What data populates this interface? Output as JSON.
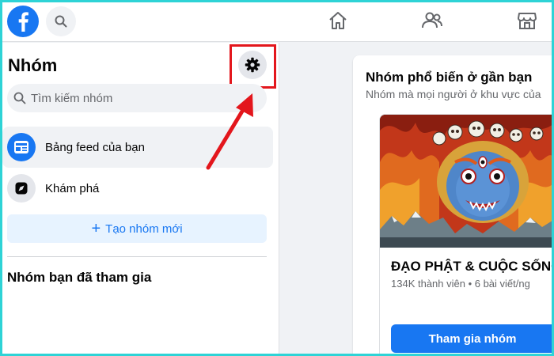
{
  "topbar": {
    "logo_icon": "facebook-logo-icon",
    "search_icon": "search-icon",
    "nav_icons": [
      "home-icon",
      "friends-icon",
      "marketplace-icon"
    ]
  },
  "sidebar": {
    "title": "Nhóm",
    "settings_icon": "gear-icon",
    "search_placeholder": "Tìm kiếm nhóm",
    "items": [
      {
        "label": "Bảng feed của bạn",
        "icon": "feed-icon",
        "active": true
      },
      {
        "label": "Khám phá",
        "icon": "compass-icon",
        "active": false
      }
    ],
    "create_label": "Tạo nhóm mới",
    "joined_title": "Nhóm bạn đã tham gia"
  },
  "main": {
    "section_title": "Nhóm phổ biến ở gần bạn",
    "section_subtitle": "Nhóm mà mọi người ở khu vực của",
    "group": {
      "name": "ĐẠO PHẬT & CUỘC SỐNG",
      "meta": "134K thành viên • 6 bài viết/ng",
      "join_label": "Tham gia nhóm"
    }
  },
  "colors": {
    "brand_blue": "#1877f2",
    "highlight_red": "#e3161c",
    "frame_cyan": "#2ed3d6"
  }
}
